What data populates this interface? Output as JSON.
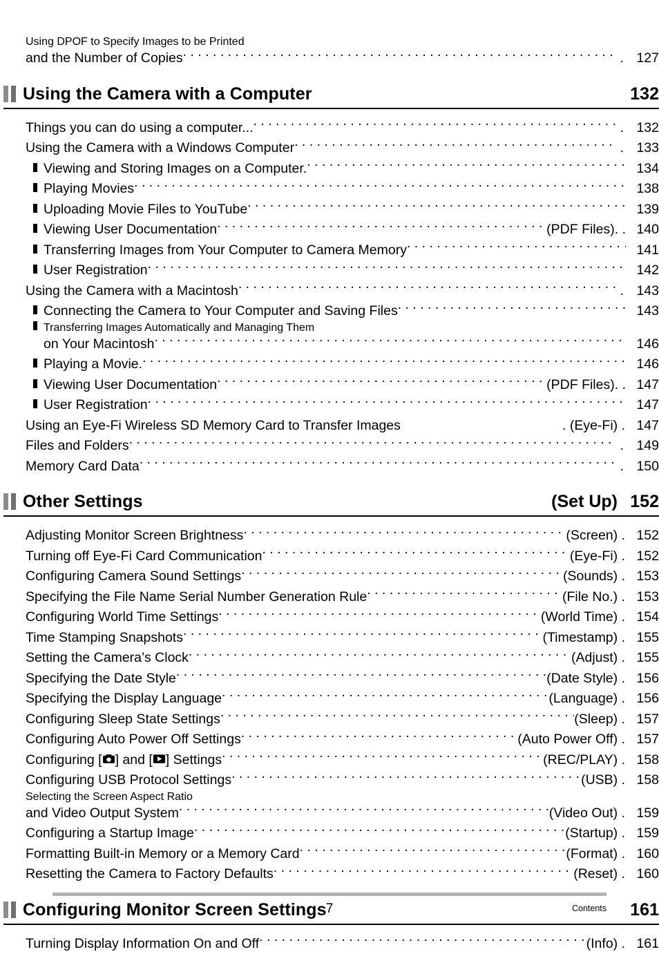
{
  "document": {
    "page_number": "7",
    "footer_label": "Contents"
  },
  "intro_entry": {
    "line1": "Using DPOF to Specify Images to be Printed",
    "line2": "and the Number of Copies",
    "page": "127"
  },
  "sections": [
    {
      "title": "Using the Camera with a Computer",
      "paren": "",
      "page": "132",
      "entries": [
        {
          "level": 1,
          "text": "Things you can do using a computer...",
          "tail": "",
          "page": "132"
        },
        {
          "level": 1,
          "text": "Using the Camera with a Windows Computer",
          "tail": "",
          "page": "133"
        },
        {
          "level": 2,
          "text": "Viewing and Storing Images on a Computer.",
          "tail": "",
          "page": "134"
        },
        {
          "level": 2,
          "text": "Playing Movies",
          "tail": "",
          "page": "138"
        },
        {
          "level": 2,
          "text": "Uploading Movie Files to YouTube",
          "tail": "",
          "page": "139"
        },
        {
          "level": 2,
          "text": "Viewing User Documentation",
          "tail": "(PDF Files). .",
          "page": "140"
        },
        {
          "level": 2,
          "text": "Transferring Images from Your Computer to Camera Memory",
          "tail": "",
          "page": "141"
        },
        {
          "level": 2,
          "text": "User Registration",
          "tail": "",
          "page": "142"
        },
        {
          "level": 1,
          "text": "Using the Camera with a Macintosh",
          "tail": "",
          "page": "143"
        },
        {
          "level": 2,
          "text": "Connecting the Camera to Your Computer and Saving Files",
          "tail": "",
          "page": "143"
        },
        {
          "level": 2,
          "text": "Transferring Images Automatically and Managing Them",
          "text2": "on Your Macintosh",
          "tail": "",
          "page": "146"
        },
        {
          "level": 2,
          "text": "Playing a Movie.",
          "tail": "",
          "page": "146"
        },
        {
          "level": 2,
          "text": "Viewing User Documentation",
          "tail": "(PDF Files). .",
          "page": "147"
        },
        {
          "level": 2,
          "text": "User Registration",
          "tail": "",
          "page": "147"
        },
        {
          "level": 1,
          "text": "Using an Eye-Fi Wireless SD Memory Card to Transfer Images",
          "tail": ". (Eye-Fi) .",
          "page": "147",
          "noleader": true
        },
        {
          "level": 1,
          "text": "Files and Folders",
          "tail": "",
          "page": "149"
        },
        {
          "level": 1,
          "text": "Memory Card Data",
          "tail": "",
          "page": "150"
        }
      ]
    },
    {
      "title": "Other Settings",
      "paren": "(Set Up)",
      "page": "152",
      "entries": [
        {
          "level": 1,
          "text": "Adjusting Monitor Screen Brightness",
          "tail": "(Screen) .",
          "page": "152"
        },
        {
          "level": 1,
          "text": "Turning off Eye-Fi Card Communication",
          "tail": "(Eye-Fi) .",
          "page": "152"
        },
        {
          "level": 1,
          "text": "Configuring Camera Sound Settings",
          "tail": "(Sounds) .",
          "page": "153"
        },
        {
          "level": 1,
          "text": "Specifying the File Name Serial Number Generation Rule",
          "tail": "(File No.) .",
          "page": "153"
        },
        {
          "level": 1,
          "text": "Configuring World Time Settings",
          "tail": "(World Time) .",
          "page": "154"
        },
        {
          "level": 1,
          "text": "Time Stamping Snapshots",
          "tail": "(Timestamp) .",
          "page": "155"
        },
        {
          "level": 1,
          "text": "Setting the Camera’s Clock",
          "tail": "(Adjust) .",
          "page": "155"
        },
        {
          "level": 1,
          "text": "Specifying the Date Style",
          "tail": "(Date Style) .",
          "page": "156"
        },
        {
          "level": 1,
          "text": "Specifying the Display Language",
          "tail": "(Language) .",
          "page": "156"
        },
        {
          "level": 1,
          "text": "Configuring Sleep State Settings",
          "tail": "(Sleep) .",
          "page": "157"
        },
        {
          "level": 1,
          "text": "Configuring Auto Power Off Settings",
          "tail": "(Auto Power Off) .",
          "page": "157"
        },
        {
          "level": 1,
          "icons": true,
          "text_a": "Configuring [",
          "text_b": "] and [",
          "text_c": "] Settings",
          "tail": "(REC/PLAY) .",
          "page": "158"
        },
        {
          "level": 1,
          "text": "Configuring USB Protocol Settings",
          "tail": "(USB) .",
          "page": "158"
        },
        {
          "level": 1,
          "text": "Selecting the Screen Aspect Ratio",
          "text2": "and Video Output System",
          "tail": "(Video Out) .",
          "page": "159"
        },
        {
          "level": 1,
          "text": "Configuring a Startup Image",
          "tail": "(Startup) .",
          "page": "159"
        },
        {
          "level": 1,
          "text": "Formatting Built-in Memory or a Memory Card",
          "tail": "(Format) .",
          "page": "160"
        },
        {
          "level": 1,
          "text": "Resetting the Camera to Factory Defaults",
          "tail": "(Reset) .",
          "page": "160"
        }
      ]
    },
    {
      "title": "Configuring Monitor Screen Settings",
      "paren": "",
      "page": "161",
      "entries": [
        {
          "level": 1,
          "text": "Turning Display Information On and Off",
          "tail": "(Info) .",
          "page": "161"
        }
      ]
    }
  ],
  "icons": {
    "camera": "camera-icon",
    "play": "play-icon",
    "section_marker": "section-marker-icon",
    "bullet": "square-bullet-icon"
  },
  "colors": {
    "text": "#000000",
    "section_marker_light": "#8c8c8c",
    "section_marker_dark": "#6f6f6f",
    "footer_rule": "#b3b3b3"
  }
}
